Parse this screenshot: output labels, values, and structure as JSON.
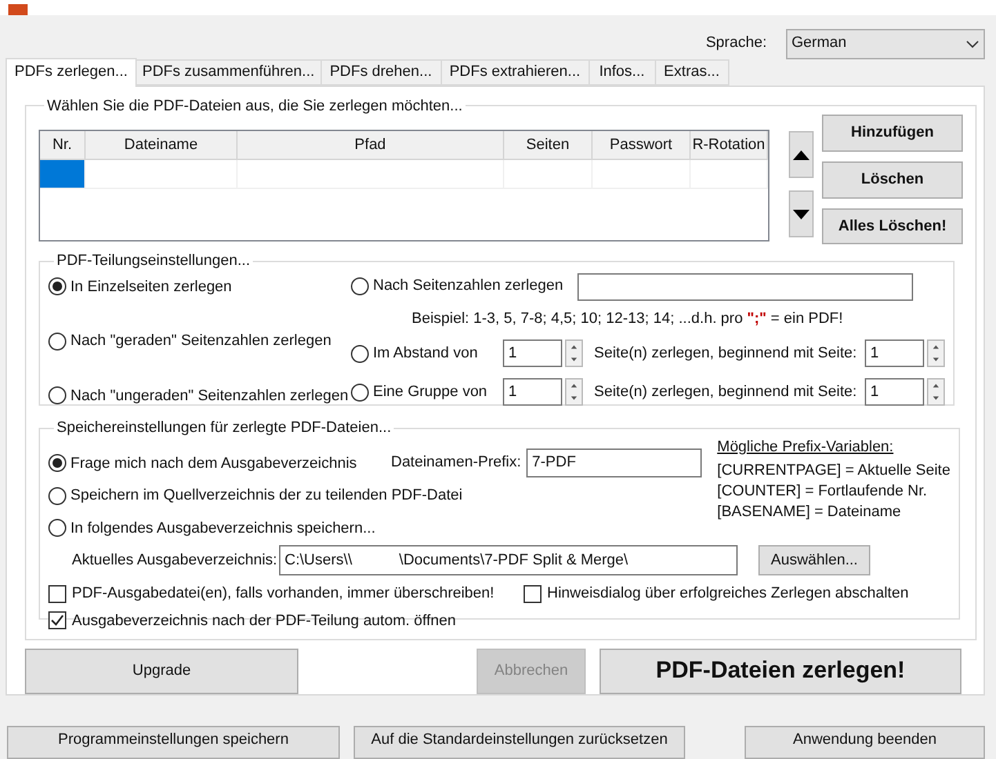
{
  "language": {
    "label": "Sprache:",
    "value": "German"
  },
  "tabs": [
    {
      "label": "PDFs zerlegen...",
      "selected": true
    },
    {
      "label": "PDFs zusammenführen...",
      "selected": false
    },
    {
      "label": "PDFs drehen...",
      "selected": false
    },
    {
      "label": "PDFs extrahieren...",
      "selected": false
    },
    {
      "label": "Infos...",
      "selected": false
    },
    {
      "label": "Extras...",
      "selected": false
    }
  ],
  "file_group": {
    "title": "Wählen Sie die PDF-Dateien aus, die Sie zerlegen möchten...",
    "columns": [
      "Nr.",
      "Dateiname",
      "Pfad",
      "Seiten",
      "Passwort",
      "R-Rotation"
    ],
    "rows": [
      {
        "selected": true
      }
    ],
    "buttons": [
      "Hinzufügen",
      "Löschen",
      "Alles Löschen!"
    ]
  },
  "split_group": {
    "title": "PDF-Teilungseinstellungen...",
    "options": [
      {
        "label": "In Einzelseiten zerlegen",
        "selected": true
      },
      {
        "label": "Nach Seitenzahlen zerlegen",
        "selected": false
      },
      {
        "label": "Nach \"geraden\" Seitenzahlen zerlegen",
        "selected": false
      },
      {
        "label": "Im Abstand von",
        "selected": false
      },
      {
        "label": "Nach \"ungeraden\" Seitenzahlen zerlegen",
        "selected": false
      },
      {
        "label": "Eine Gruppe von",
        "selected": false
      }
    ],
    "example": "Beispiel: 1-3, 5, 7-8; 4,5; 10; 12-13; 14; ...d.h. pro **\";\"** = ein PDF!",
    "interval": {
      "count": "1",
      "text": "Seite(n) zerlegen, beginnend mit Seite:",
      "start": "1"
    },
    "group": {
      "count": "1",
      "text": "Seite(n) zerlegen, beginnend mit Seite:",
      "start": "1"
    }
  },
  "save_group": {
    "title": "Speichereinstellungen für zerlegte PDF-Dateien...",
    "options": [
      {
        "label": "Frage mich nach dem Ausgabeverzeichnis",
        "selected": true
      },
      {
        "label": "Speichern im Quellverzeichnis der zu teilenden PDF-Datei",
        "selected": false
      },
      {
        "label": "In folgendes Ausgabeverzeichnis speichern...",
        "selected": false
      }
    ],
    "prefix": {
      "label": "Dateinamen-Prefix:",
      "value": "7-PDF"
    },
    "prefix_vars": {
      "title": "Mögliche Prefix-Variablen:",
      "lines": [
        "[CURRENTPAGE] = Aktuelle Seite",
        "[COUNTER] = Fortlaufende Nr.",
        "[BASENAME] = Dateiname"
      ]
    },
    "output_dir": {
      "label": "Aktuelles Ausgabeverzeichnis:",
      "path_start": "C:\\Users\\\\",
      "path_end": "\\Documents\\7-PDF Split & Merge\\",
      "button": "Auswählen..."
    },
    "checkboxes": [
      {
        "label": "PDF-Ausgabedatei(en), falls vorhanden, immer überschreiben!",
        "checked": false
      },
      {
        "label": "Hinweisdialog über erfolgreiches Zerlegen abschalten",
        "checked": false
      },
      {
        "label": "Ausgabeverzeichnis nach der PDF-Teilung autom. öffnen",
        "checked": true
      }
    ]
  },
  "actions": [
    {
      "label": "Upgrade",
      "kind": "upgrade",
      "disabled": false
    },
    {
      "label": "Abbrechen",
      "kind": "cancel",
      "disabled": true
    },
    {
      "label": "PDF-Dateien zerlegen!",
      "kind": "primary",
      "disabled": false
    }
  ],
  "footer_buttons": [
    "Programmeinstellungen speichern",
    "Auf die Standardeinstellungen zurücksetzen",
    "Anwendung beenden"
  ]
}
